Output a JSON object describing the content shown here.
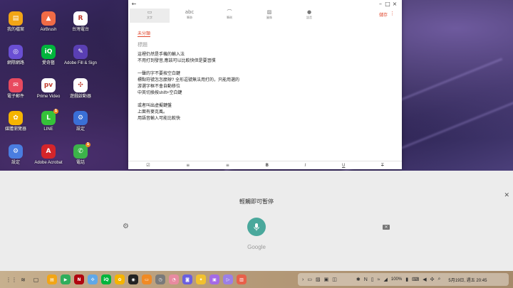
{
  "desktop": {
    "icons": [
      {
        "label": "我的檔案",
        "color": "#f2a516",
        "glyph": "▤",
        "icon": "folder-icon"
      },
      {
        "label": "AirBrush",
        "color": "#f06b46",
        "glyph": "▲",
        "icon": "airbrush-icon"
      },
      {
        "label": "台灣電台",
        "color": "#ffffff",
        "glyph": "R",
        "icon": "radio-icon"
      },
      {
        "label": "網際網路",
        "color": "#6a4fd3",
        "glyph": "◎",
        "icon": "internet-icon"
      },
      {
        "label": "愛奇藝",
        "color": "#00b53c",
        "glyph": "iQ",
        "icon": "iqiyi-icon"
      },
      {
        "label": "Adobe Fill & Sign",
        "color": "#5a3fb3",
        "glyph": "✎",
        "icon": "fill-sign-icon"
      },
      {
        "label": "電子郵件",
        "color": "#e84a5f",
        "glyph": "✉",
        "icon": "email-icon"
      },
      {
        "label": "Prime Video",
        "color": "#ffffff",
        "glyph": "pv",
        "icon": "prime-video-icon"
      },
      {
        "label": "遊戲啟動器",
        "color": "#ffffff",
        "glyph": "✣",
        "icon": "game-launcher-icon"
      },
      {
        "label": "媒體瀏覽器",
        "color": "#f5b400",
        "glyph": "✿",
        "icon": "media-browser-icon"
      },
      {
        "label": "LINE",
        "color": "#35c239",
        "glyph": "L",
        "icon": "line-icon",
        "badge": "1"
      },
      {
        "label": "設定",
        "color": "#3a6fd6",
        "glyph": "⚙",
        "icon": "settings-icon"
      },
      {
        "label": "設定",
        "color": "#4a7de0",
        "glyph": "⚙",
        "icon": "settings-icon"
      },
      {
        "label": "Adobe Acrobat",
        "color": "#d4252a",
        "glyph": "A",
        "icon": "acrobat-icon"
      },
      {
        "label": "電話",
        "color": "#3cb34a",
        "glyph": "✆",
        "icon": "phone-icon",
        "badge": "1"
      }
    ]
  },
  "memo": {
    "modes": [
      {
        "label": "文字",
        "glyph": "▭",
        "icon": "text-mode-icon"
      },
      {
        "label": "筆跡",
        "glyph": "abc",
        "icon": "handwriting-mode-icon"
      },
      {
        "label": "筆刷",
        "glyph": "⌒",
        "icon": "brush-mode-icon"
      },
      {
        "label": "圖像",
        "glyph": "▨",
        "icon": "image-mode-icon"
      },
      {
        "label": "語音",
        "glyph": "●",
        "icon": "voice-mode-icon"
      }
    ],
    "save_label": "儲存",
    "category": "未分類",
    "title_placeholder": "標題",
    "body_lines": [
      "這裡仍然是手機的輸入法",
      "不用打到發音,應該可以比較快但是要習慣",
      "",
      "一聲的字不要按空白鍵",
      "標點符號怎怎麼辦? 全形逗號無法用打的，只能用選的",
      "游選字框不會自動移位",
      "中英切換按shift+空白鍵",
      "",
      "或者叫出虛擬鍵盤",
      "上面有麥克風。",
      "用語音輸入可能比較快"
    ],
    "format_tools": [
      "☑",
      "≡",
      "≡",
      "B",
      "I",
      "U",
      "T"
    ]
  },
  "voice_input": {
    "hint": "輕觸即可暫停",
    "brand": "Google"
  },
  "taskbar": {
    "apps": [
      {
        "color": "#f2a516",
        "glyph": "▤"
      },
      {
        "color": "#2fae5c",
        "glyph": "▶"
      },
      {
        "color": "#b0060f",
        "glyph": "N"
      },
      {
        "color": "#5fa8e8",
        "glyph": "✣"
      },
      {
        "color": "#00b53c",
        "glyph": "iQ"
      },
      {
        "color": "#f5b400",
        "glyph": "✿"
      },
      {
        "color": "#222222",
        "glyph": "◉"
      },
      {
        "color": "#f08a24",
        "glyph": "▭"
      },
      {
        "color": "#7a7a7a",
        "glyph": "◷"
      },
      {
        "color": "#e88aa0",
        "glyph": "◔"
      },
      {
        "color": "#6a5fe0",
        "glyph": "◙"
      },
      {
        "color": "#f2c12e",
        "glyph": "✦"
      },
      {
        "color": "#a46ae6",
        "glyph": "▣"
      },
      {
        "color": "#9b7fe6",
        "glyph": "▷"
      },
      {
        "color": "#e8604a",
        "glyph": "▥"
      }
    ],
    "battery": "100%",
    "datetime": "5月19日, 週五 20:45"
  }
}
